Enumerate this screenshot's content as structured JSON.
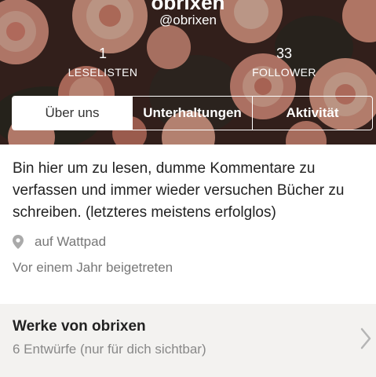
{
  "profile": {
    "display_name": "obrixen",
    "username": "@obrixen"
  },
  "stats": [
    {
      "value": "1",
      "label": "LESELISTEN"
    },
    {
      "value": "33",
      "label": "FOLLOWER"
    }
  ],
  "tabs": [
    {
      "label": "Über uns",
      "active": true
    },
    {
      "label": "Unterhaltungen",
      "active": false
    },
    {
      "label": "Aktivität",
      "active": false
    }
  ],
  "about": {
    "bio": "Bin hier um zu lesen, dumme Kommentare zu verfassen und immer wieder versuchen Bücher zu schreiben. (letzteres meistens erfolglos)",
    "location": "auf Wattpad",
    "joined": "Vor einem Jahr beigetreten",
    "location_icon": "map-pin-icon"
  },
  "works": {
    "title": "Werke von obrixen",
    "subtitle": "6 Entwürfe (nur für dich sichtbar)",
    "chevron_icon": "chevron-right-icon"
  },
  "colors": {
    "rose_light": "#f2b6a0",
    "rose_mid": "#e48c78",
    "leaf": "#2d2a22"
  }
}
